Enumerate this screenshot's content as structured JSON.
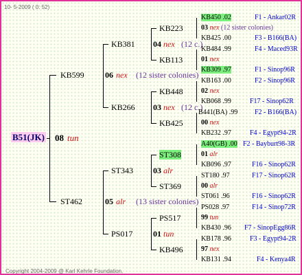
{
  "header": {
    "date_text": "10- 5-2009 ( 0: 52)"
  },
  "footer": {
    "copyright": "Copyright 2004-2009 @ Karl Kehrle Foundation."
  },
  "root": {
    "id": "B51(JK)",
    "code": "08",
    "breed": "tun"
  },
  "gen1": {
    "sire": {
      "id": "KB599"
    },
    "sire_dam": {
      "code": "06",
      "breed": "nex",
      "colonies": "(12 sister colonies)"
    },
    "dam": {
      "id": "ST462"
    },
    "dam_dam": {
      "code": "05",
      "breed": "alr",
      "colonies": "(13 sister colonies)"
    }
  },
  "gen2": {
    "a": {
      "id": "KB381",
      "code": "04",
      "breed": "nex",
      "colonies": "(12 c.)"
    },
    "b": {
      "id": "KB266",
      "code": "03",
      "breed": "nex",
      "colonies": "(12 c.)"
    },
    "c": {
      "id": "ST343",
      "code": "03",
      "breed": "alr"
    },
    "d": {
      "id": "PS017",
      "code": "01",
      "breed": "tun"
    }
  },
  "gen3": [
    {
      "id": "KB223",
      "highlight": false
    },
    {
      "id": "KB113",
      "highlight": false
    },
    {
      "id": "KB448",
      "highlight": false
    },
    {
      "id": "KB425",
      "highlight": false
    },
    {
      "id": "ST308",
      "highlight": true
    },
    {
      "id": "ST369",
      "highlight": false
    },
    {
      "id": "PS517",
      "highlight": false
    },
    {
      "id": "KB496",
      "highlight": false
    }
  ],
  "gen4": [
    {
      "id": "KB450",
      "yr": ".02",
      "highlight": true,
      "ref": "F1 - Ankar02R"
    },
    {
      "code": "03",
      "breed": "nex",
      "note": "(12 sister colonies)"
    },
    {
      "id": "KB425",
      "yr": ".00",
      "ref": "F3 - B166(BA)"
    },
    {
      "id": "KB484",
      "yr": ".99",
      "ref": "F4 - Maced93R"
    },
    {
      "code": "01",
      "breed": "nex"
    },
    {
      "id": "KB309",
      "yr": ".97",
      "highlight": true,
      "ref": "F1 - Sinop96R"
    },
    {
      "id": "KB163",
      "yr": ".00",
      "ref": "F2 - Sinop96R"
    },
    {
      "code": "02",
      "breed": "nex"
    },
    {
      "id": "KB068",
      "yr": ".99",
      "ref": "F17 - Sinop62R"
    },
    {
      "id": "B441(BA)",
      "yr": ".99",
      "ref": "F2 - B166(BA)"
    },
    {
      "code": "00",
      "breed": "nex"
    },
    {
      "id": "KB232",
      "yr": ".97",
      "ref": "F4 - Egypt94-2R"
    },
    {
      "id": "A40(GB)",
      "yr": ".00",
      "highlight": true,
      "ref": "F2 - Bayburt98-3R"
    },
    {
      "code": "01",
      "breed": "alr"
    },
    {
      "id": "KB096",
      "yr": ".97",
      "ref": "F16 - Sinop62R"
    },
    {
      "id": "ST180",
      "yr": ".97",
      "ref": "F17 - Sinop62R"
    },
    {
      "code": "00",
      "breed": "alr"
    },
    {
      "id": "ST061",
      "yr": ".96",
      "ref": "F16 - Sinop62R"
    },
    {
      "id": "PS028",
      "yr": ".97",
      "ref": "F14 - Sinop72R"
    },
    {
      "code": "99",
      "breed": "tun"
    },
    {
      "id": "KB430",
      "yr": ".96",
      "ref": "F7 - SinopEgg86R"
    },
    {
      "id": "KB178",
      "yr": ".96",
      "ref": "F3 - Egypt94-2R"
    },
    {
      "code": "97",
      "breed": "nex"
    },
    {
      "id": "KB131",
      "yr": ".94",
      "ref": "F4 - Kenya4R"
    }
  ]
}
